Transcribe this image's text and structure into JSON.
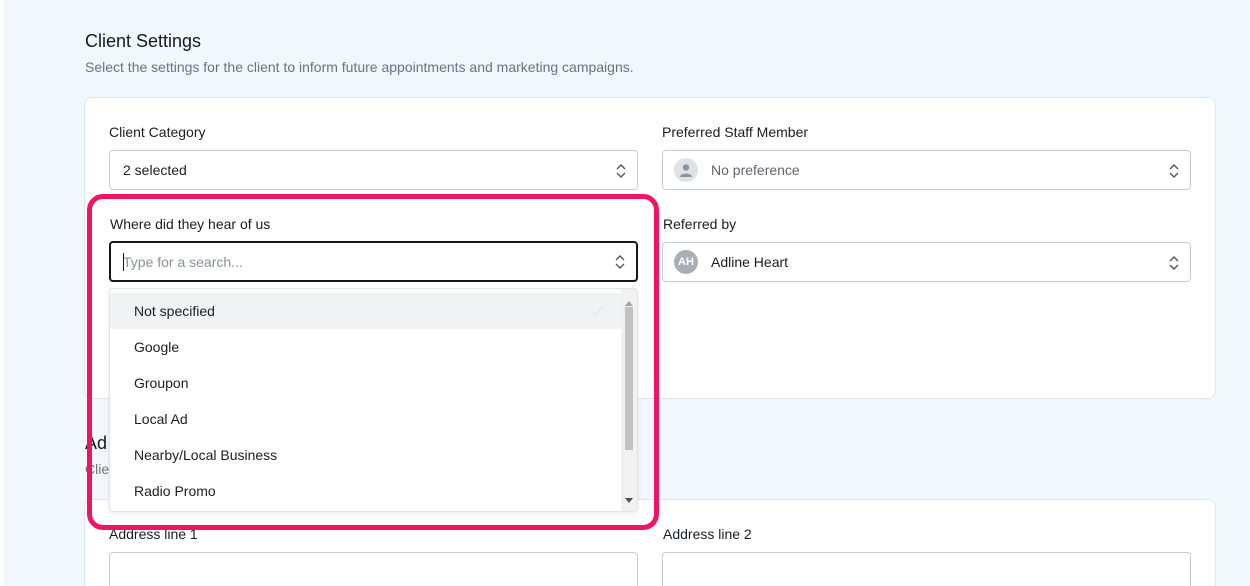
{
  "section": {
    "title": "Client Settings",
    "description": "Select the settings for the client to inform future appointments and marketing campaigns."
  },
  "client_category": {
    "label": "Client Category",
    "value": "2 selected"
  },
  "preferred_staff": {
    "label": "Preferred Staff Member",
    "value": "No preference"
  },
  "heard_of_us": {
    "label": "Where did they hear of us",
    "placeholder": "Type for a search...",
    "options": [
      "Not specified",
      "Google",
      "Groupon",
      "Local Ad",
      "Nearby/Local Business",
      "Radio Promo"
    ],
    "selected": "Not specified"
  },
  "referred_by": {
    "label": "Referred by",
    "initials": "AH",
    "value": "Adline Heart"
  },
  "address_section": {
    "title_peek": "Ad",
    "desc_peek": "Clie"
  },
  "address": {
    "line1_label": "Address line 1",
    "line2_label": "Address line 2"
  },
  "colors": {
    "highlight": "#ee1565",
    "focus_border": "#14171f"
  }
}
